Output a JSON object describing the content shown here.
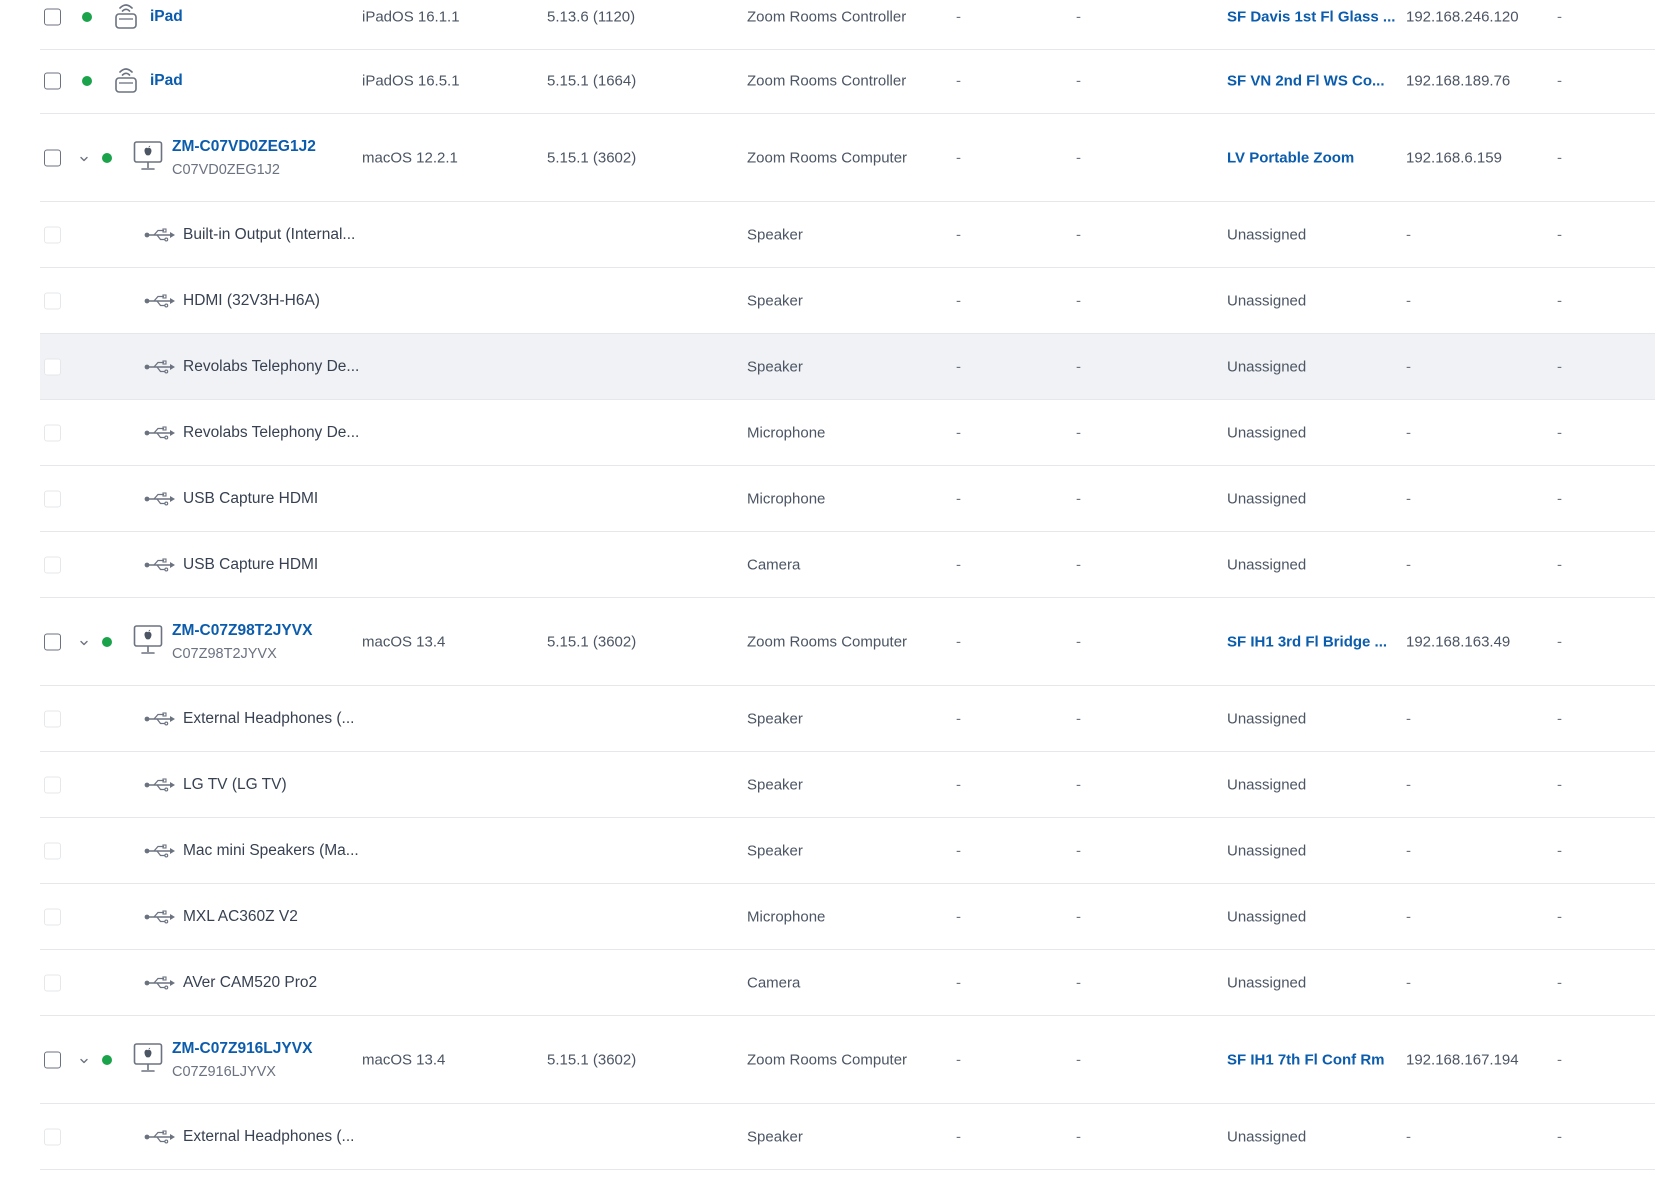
{
  "colors": {
    "online": "#1aa34a",
    "link": "#0b5cad",
    "hover_row": "#f1f2f5"
  },
  "icons": {
    "controller": "ipad-wireless-icon",
    "computer": "imac-apple-icon",
    "peripheral": "usb-icon",
    "expand": "chevron-down-icon"
  },
  "rows": [
    {
      "kind": "controller",
      "name": "iPad",
      "os": "iPadOS 16.1.1",
      "version": "5.13.6 (1120)",
      "type": "Zoom Rooms Controller",
      "col_a": "-",
      "col_b": "-",
      "location": "SF Davis 1st Fl Glass ...",
      "ip": "192.168.246.120",
      "last": "-"
    },
    {
      "kind": "controller",
      "name": "iPad",
      "os": "iPadOS 16.5.1",
      "version": "5.15.1 (1664)",
      "type": "Zoom Rooms Controller",
      "col_a": "-",
      "col_b": "-",
      "location": "SF VN 2nd Fl WS Co...",
      "ip": "192.168.189.76",
      "last": "-"
    },
    {
      "kind": "computer",
      "name": "ZM-C07VD0ZEG1J2",
      "serial": "C07VD0ZEG1J2",
      "os": "macOS 12.2.1",
      "version": "5.15.1 (3602)",
      "type": "Zoom Rooms Computer",
      "col_a": "-",
      "col_b": "-",
      "location": "LV Portable Zoom",
      "ip": "192.168.6.159",
      "last": "-"
    },
    {
      "kind": "peripheral",
      "name": "Built-in Output (Internal...",
      "type": "Speaker",
      "col_a": "-",
      "col_b": "-",
      "location": "Unassigned",
      "ip": "-",
      "last": "-"
    },
    {
      "kind": "peripheral",
      "name": "HDMI (32V3H-H6A)",
      "type": "Speaker",
      "col_a": "-",
      "col_b": "-",
      "location": "Unassigned",
      "ip": "-",
      "last": "-"
    },
    {
      "kind": "peripheral",
      "name": "Revolabs Telephony De...",
      "type": "Speaker",
      "col_a": "-",
      "col_b": "-",
      "location": "Unassigned",
      "ip": "-",
      "last": "-",
      "hover": true
    },
    {
      "kind": "peripheral",
      "name": "Revolabs Telephony De...",
      "type": "Microphone",
      "col_a": "-",
      "col_b": "-",
      "location": "Unassigned",
      "ip": "-",
      "last": "-"
    },
    {
      "kind": "peripheral",
      "name": "USB Capture HDMI",
      "type": "Microphone",
      "col_a": "-",
      "col_b": "-",
      "location": "Unassigned",
      "ip": "-",
      "last": "-"
    },
    {
      "kind": "peripheral",
      "name": "USB Capture HDMI",
      "type": "Camera",
      "col_a": "-",
      "col_b": "-",
      "location": "Unassigned",
      "ip": "-",
      "last": "-"
    },
    {
      "kind": "computer",
      "name": "ZM-C07Z98T2JYVX",
      "serial": "C07Z98T2JYVX",
      "os": "macOS 13.4",
      "version": "5.15.1 (3602)",
      "type": "Zoom Rooms Computer",
      "col_a": "-",
      "col_b": "-",
      "location": "SF IH1 3rd Fl Bridge ...",
      "ip": "192.168.163.49",
      "last": "-"
    },
    {
      "kind": "peripheral",
      "name": "External Headphones (...",
      "type": "Speaker",
      "col_a": "-",
      "col_b": "-",
      "location": "Unassigned",
      "ip": "-",
      "last": "-"
    },
    {
      "kind": "peripheral",
      "name": "LG TV (LG TV)",
      "type": "Speaker",
      "col_a": "-",
      "col_b": "-",
      "location": "Unassigned",
      "ip": "-",
      "last": "-"
    },
    {
      "kind": "peripheral",
      "name": "Mac mini Speakers (Ma...",
      "type": "Speaker",
      "col_a": "-",
      "col_b": "-",
      "location": "Unassigned",
      "ip": "-",
      "last": "-"
    },
    {
      "kind": "peripheral",
      "name": "MXL AC360Z V2",
      "type": "Microphone",
      "col_a": "-",
      "col_b": "-",
      "location": "Unassigned",
      "ip": "-",
      "last": "-"
    },
    {
      "kind": "peripheral",
      "name": "AVer CAM520 Pro2",
      "type": "Camera",
      "col_a": "-",
      "col_b": "-",
      "location": "Unassigned",
      "ip": "-",
      "last": "-"
    },
    {
      "kind": "computer",
      "name": "ZM-C07Z916LJYVX",
      "serial": "C07Z916LJYVX",
      "os": "macOS 13.4",
      "version": "5.15.1 (3602)",
      "type": "Zoom Rooms Computer",
      "col_a": "-",
      "col_b": "-",
      "location": "SF IH1 7th Fl Conf Rm",
      "ip": "192.168.167.194",
      "last": "-"
    },
    {
      "kind": "peripheral",
      "name": "External Headphones (...",
      "type": "Speaker",
      "col_a": "-",
      "col_b": "-",
      "location": "Unassigned",
      "ip": "-",
      "last": "-"
    }
  ]
}
